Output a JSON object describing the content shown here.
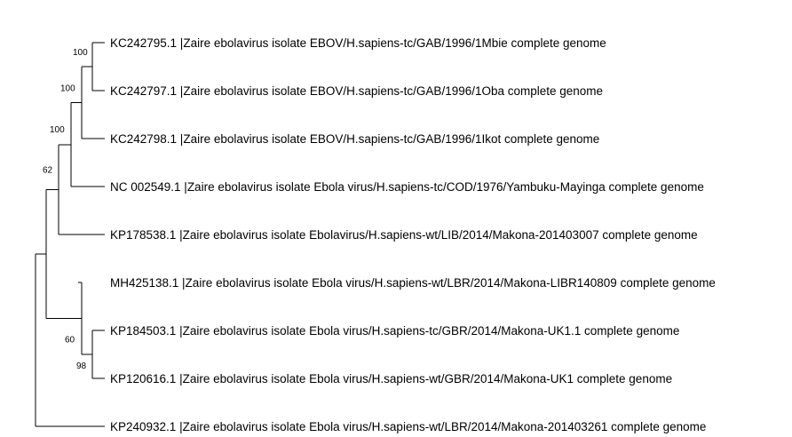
{
  "tree": {
    "leaves": [
      {
        "id": "L1",
        "label": "KC242795.1 |Zaire ebolavirus isolate EBOV/H.sapiens-tc/GAB/1996/1Mbie complete genome"
      },
      {
        "id": "L2",
        "label": "KC242797.1 |Zaire ebolavirus isolate EBOV/H.sapiens-tc/GAB/1996/1Oba complete genome"
      },
      {
        "id": "L3",
        "label": "KC242798.1 |Zaire ebolavirus isolate EBOV/H.sapiens-tc/GAB/1996/1Ikot complete genome"
      },
      {
        "id": "L4",
        "label": "NC 002549.1 |Zaire ebolavirus isolate Ebola virus/H.sapiens-tc/COD/1976/Yambuku-Mayinga complete genome"
      },
      {
        "id": "L5",
        "label": "KP178538.1 |Zaire ebolavirus isolate Ebolavirus/H.sapiens-wt/LIB/2014/Makona-201403007 complete genome"
      },
      {
        "id": "L6",
        "label": "MH425138.1 |Zaire ebolavirus isolate Ebola virus/H.sapiens-wt/LBR/2014/Makona-LIBR140809 complete genome"
      },
      {
        "id": "L7",
        "label": "KP184503.1 |Zaire ebolavirus isolate Ebola virus/H.sapiens-tc/GBR/2014/Makona-UK1.1 complete genome"
      },
      {
        "id": "L8",
        "label": "KP120616.1 |Zaire ebolavirus isolate Ebola virus/H.sapiens-wt/GBR/2014/Makona-UK1 complete genome"
      },
      {
        "id": "L9",
        "label": "KP240932.1 |Zaire ebolavirus isolate Ebola virus/H.sapiens-wt/LBR/2014/Makona-201403261 complete genome"
      }
    ],
    "support_values": {
      "node_L1_L2": "100",
      "node_L1_L3": "100",
      "node_L1_L4": "100",
      "node_L1_L5": "62",
      "node_L7_L8": "98",
      "node_L6_L8": "60"
    }
  }
}
